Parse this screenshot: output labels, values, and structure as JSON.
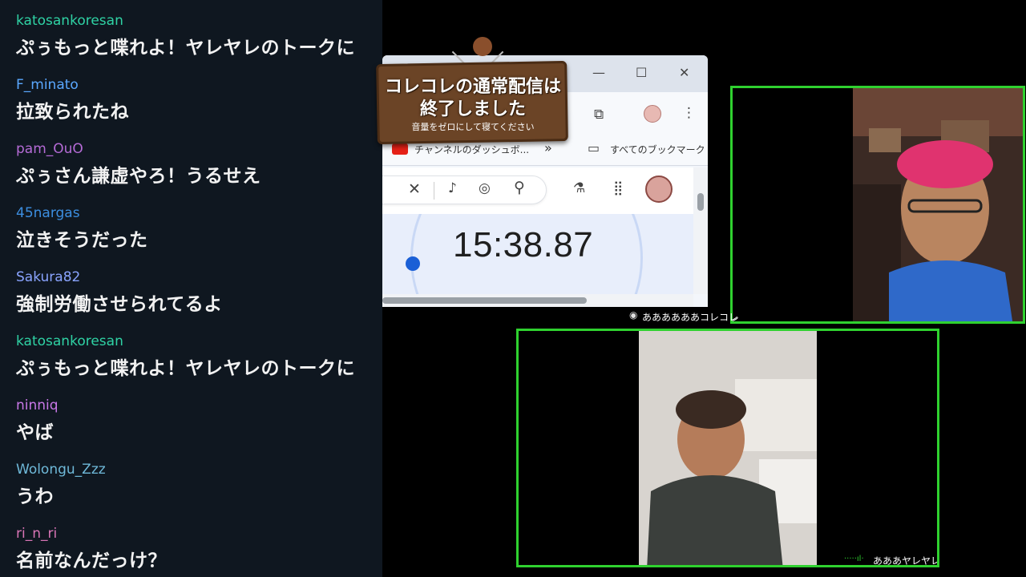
{
  "chat": {
    "messages": [
      {
        "user": "katosankoresan",
        "color": "#2fd3a5",
        "text": "ぷぅもっと喋れよ！ヤレヤレのトークに"
      },
      {
        "user": "F_minato",
        "color": "#5aa8ff",
        "text": "拉致られたね"
      },
      {
        "user": "pam_OuO",
        "color": "#b56bd6",
        "text": "ぷぅさん謙虚やろ！うるせえ"
      },
      {
        "user": "45nargas",
        "color": "#3c8ee0",
        "text": "泣きそうだった"
      },
      {
        "user": "Sakura82",
        "color": "#8aa4ff",
        "text": "強制労働させられてるよ"
      },
      {
        "user": "katosankoresan",
        "color": "#2fd3a5",
        "text": "ぷぅもっと喋れよ！ヤレヤレのトークに"
      },
      {
        "user": "ninniq",
        "color": "#c978e8",
        "text": "やば"
      },
      {
        "user": "Wolongu_Zzz",
        "color": "#6fb9d9",
        "text": "うわ"
      },
      {
        "user": "ri_n_ri",
        "color": "#d975b6",
        "text": "名前なんだっけ？"
      }
    ]
  },
  "sign": {
    "line1": "コレコレの通常配信は",
    "line2": "終了しました",
    "line3": "音量をゼロにして寝てください"
  },
  "browser": {
    "bookmark_item": "チャンネルのダッシュボ...",
    "bookmark_more": "»",
    "all_bookmarks": "すべてのブックマーク",
    "timer": "15:38.87",
    "icons": {
      "minimize": "minimize-icon",
      "maximize": "maximize-icon",
      "close": "close-icon",
      "extensions": "puzzle-icon",
      "menu": "kebab-menu-icon",
      "folder": "folder-icon",
      "clear": "clear-icon",
      "mic": "microphone-icon",
      "lens": "lens-icon",
      "search": "search-icon",
      "labs": "flask-icon",
      "apps": "apps-grid-icon"
    }
  },
  "tiles": {
    "top_right_label": "ああああああコレコレ",
    "bottom_label": "あああヤレヤレ",
    "border_color": "#2fd12f"
  },
  "colors": {
    "chat_bg": "#0f1720",
    "chat_text": "#f2f2f2",
    "sign_wood": "#6b4426"
  }
}
